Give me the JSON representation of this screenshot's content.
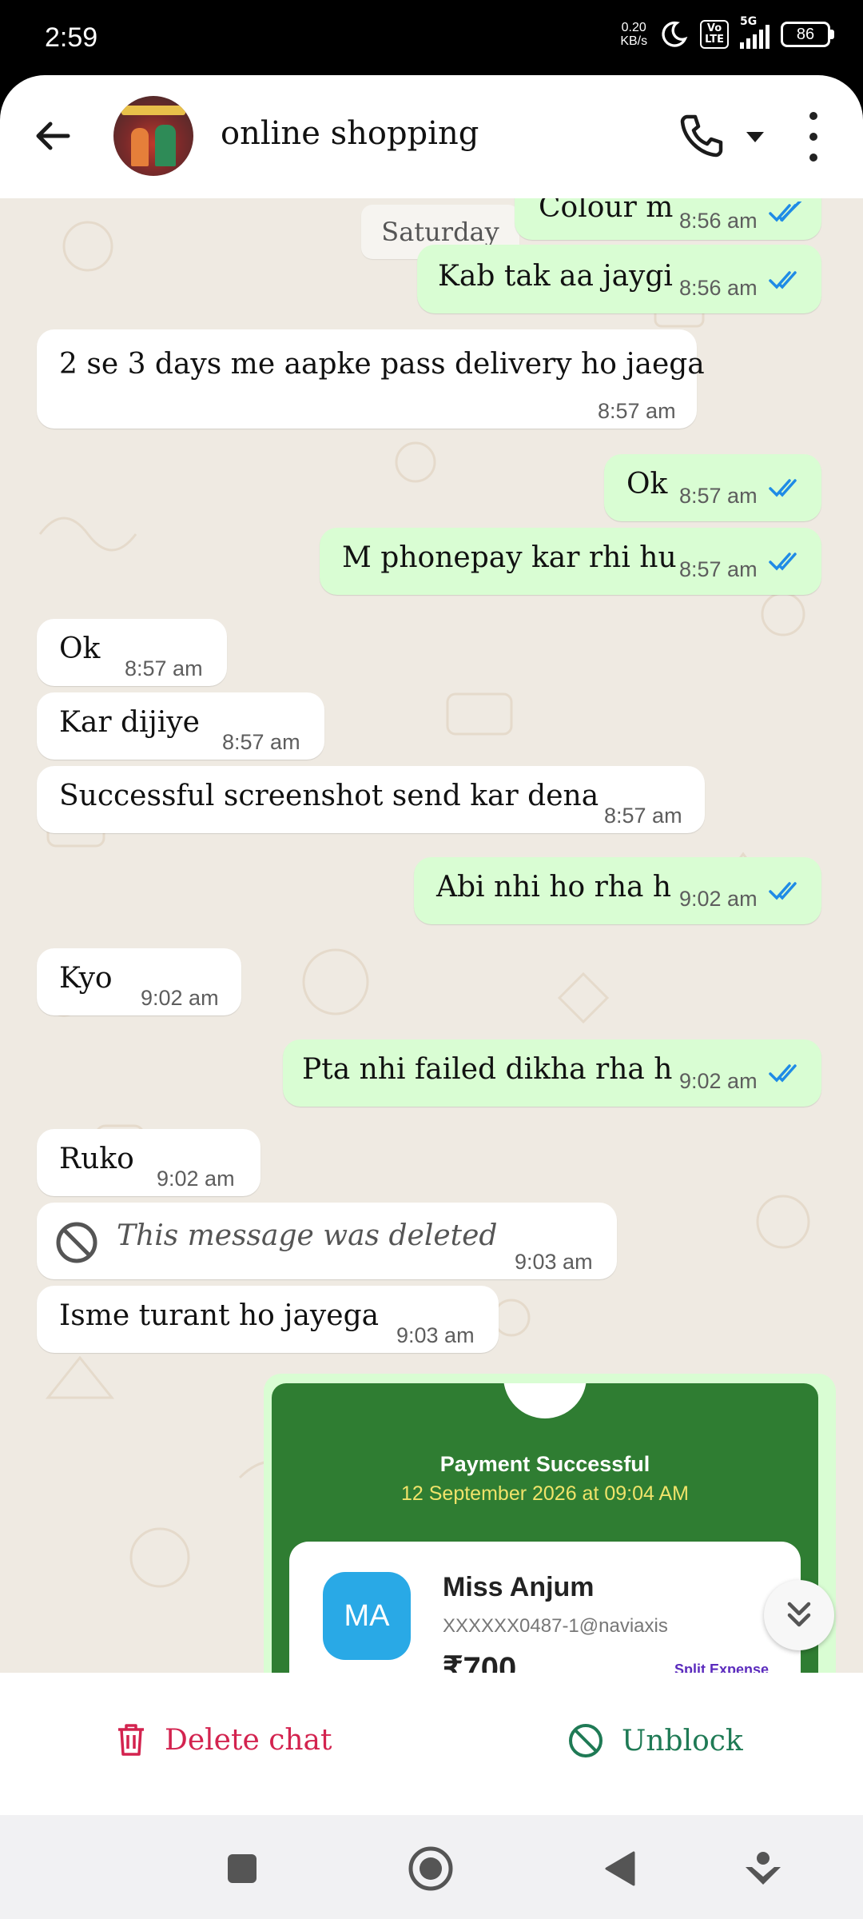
{
  "status_bar": {
    "time": "2:59",
    "net_speed_value": "0.20",
    "net_speed_unit": "KB/s",
    "volte_top": "Vo",
    "volte_bottom": "LTE",
    "network": "5G",
    "battery": "86"
  },
  "header": {
    "chat_name": "online shopping"
  },
  "chat": {
    "date_chip": "Saturday",
    "messages": [
      {
        "direction": "out",
        "text": "Colour m",
        "time": "8:56 am",
        "ticks": "read"
      },
      {
        "direction": "out",
        "text": "Kab tak aa jaygi",
        "time": "8:56 am",
        "ticks": "read"
      },
      {
        "direction": "in",
        "text": "2 se 3 days me aapke pass delivery ho jaega",
        "time": "8:57 am"
      },
      {
        "direction": "out",
        "text": "Ok",
        "time": "8:57 am",
        "ticks": "read"
      },
      {
        "direction": "out",
        "text": "M phonepay kar rhi hu",
        "time": "8:57 am",
        "ticks": "read"
      },
      {
        "direction": "in",
        "text": "Ok",
        "time": "8:57 am"
      },
      {
        "direction": "in",
        "text": "Kar dijiye",
        "time": "8:57 am"
      },
      {
        "direction": "in",
        "text": "Successful screenshot send kar dena",
        "time": "8:57 am"
      },
      {
        "direction": "out",
        "text": "Abi nhi ho rha h",
        "time": "9:02 am",
        "ticks": "read"
      },
      {
        "direction": "in",
        "text": "Kyo",
        "time": "9:02 am"
      },
      {
        "direction": "out",
        "text": "Pta nhi failed dikha rha h",
        "time": "9:02 am",
        "ticks": "read"
      },
      {
        "direction": "in",
        "text": "Ruko",
        "time": "9:02 am"
      },
      {
        "direction": "in",
        "text": "This message was deleted",
        "time": "9:03 am",
        "deleted": true
      },
      {
        "direction": "in",
        "text": "Isme turant ho jayega",
        "time": "9:03 am"
      }
    ],
    "payment": {
      "title": "Payment Successful",
      "date": "12 September 2026 at 09:04 AM",
      "initials": "MA",
      "name": "Miss Anjum",
      "upi": "XXXXXX0487-1@naviaxis",
      "amount": "₹700",
      "split_label": "Split Expense"
    }
  },
  "actions": {
    "delete_label": "Delete chat",
    "unblock_label": "Unblock"
  },
  "colors": {
    "accent_delete": "#d3234f",
    "accent_unblock": "#1f7a55",
    "outgoing_bubble": "#d9fdd3",
    "tick_blue": "#1f8be6",
    "payment_green": "#2f7d32"
  },
  "icons": [
    "back-arrow-icon",
    "phone-icon",
    "dropdown-icon",
    "more-vert-icon",
    "double-tick-icon",
    "blocked-icon",
    "trash-icon",
    "chevron-double-down-icon",
    "nav-square-icon",
    "nav-home-icon",
    "nav-back-icon",
    "nav-assist-icon"
  ]
}
